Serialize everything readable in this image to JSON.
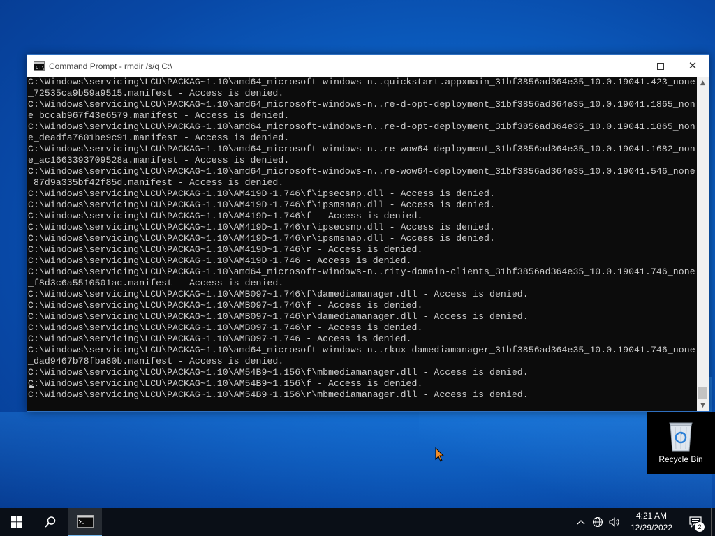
{
  "window": {
    "title": "Command Prompt - rmdir /s/q C:\\",
    "icon": "cmd-icon",
    "icon_text": "C:\\_"
  },
  "console": {
    "lines": [
      "C:\\Windows\\servicing\\LCU\\PACKAG~1.10\\amd64_microsoft-windows-n..quickstart.appxmain_31bf3856ad364e35_10.0.19041.423_none",
      "_72535ca9b59a9515.manifest - Access is denied.",
      "C:\\Windows\\servicing\\LCU\\PACKAG~1.10\\amd64_microsoft-windows-n..re-d-opt-deployment_31bf3856ad364e35_10.0.19041.1865_non",
      "e_bccab967f43e6579.manifest - Access is denied.",
      "C:\\Windows\\servicing\\LCU\\PACKAG~1.10\\amd64_microsoft-windows-n..re-d-opt-deployment_31bf3856ad364e35_10.0.19041.1865_non",
      "e_deadfa7601be9c91.manifest - Access is denied.",
      "C:\\Windows\\servicing\\LCU\\PACKAG~1.10\\amd64_microsoft-windows-n..re-wow64-deployment_31bf3856ad364e35_10.0.19041.1682_non",
      "e_ac1663393709528a.manifest - Access is denied.",
      "C:\\Windows\\servicing\\LCU\\PACKAG~1.10\\amd64_microsoft-windows-n..re-wow64-deployment_31bf3856ad364e35_10.0.19041.546_none",
      "_87d9a335bf42f85d.manifest - Access is denied.",
      "C:\\Windows\\servicing\\LCU\\PACKAG~1.10\\AM419D~1.746\\f\\ipsecsnp.dll - Access is denied.",
      "C:\\Windows\\servicing\\LCU\\PACKAG~1.10\\AM419D~1.746\\f\\ipsmsnap.dll - Access is denied.",
      "C:\\Windows\\servicing\\LCU\\PACKAG~1.10\\AM419D~1.746\\f - Access is denied.",
      "C:\\Windows\\servicing\\LCU\\PACKAG~1.10\\AM419D~1.746\\r\\ipsecsnp.dll - Access is denied.",
      "C:\\Windows\\servicing\\LCU\\PACKAG~1.10\\AM419D~1.746\\r\\ipsmsnap.dll - Access is denied.",
      "C:\\Windows\\servicing\\LCU\\PACKAG~1.10\\AM419D~1.746\\r - Access is denied.",
      "C:\\Windows\\servicing\\LCU\\PACKAG~1.10\\AM419D~1.746 - Access is denied.",
      "C:\\Windows\\servicing\\LCU\\PACKAG~1.10\\amd64_microsoft-windows-n..rity-domain-clients_31bf3856ad364e35_10.0.19041.746_none",
      "_f8d3c6a5510501ac.manifest - Access is denied.",
      "C:\\Windows\\servicing\\LCU\\PACKAG~1.10\\AMB097~1.746\\f\\damediamanager.dll - Access is denied.",
      "C:\\Windows\\servicing\\LCU\\PACKAG~1.10\\AMB097~1.746\\f - Access is denied.",
      "C:\\Windows\\servicing\\LCU\\PACKAG~1.10\\AMB097~1.746\\r\\damediamanager.dll - Access is denied.",
      "C:\\Windows\\servicing\\LCU\\PACKAG~1.10\\AMB097~1.746\\r - Access is denied.",
      "C:\\Windows\\servicing\\LCU\\PACKAG~1.10\\AMB097~1.746 - Access is denied.",
      "C:\\Windows\\servicing\\LCU\\PACKAG~1.10\\amd64_microsoft-windows-n..rkux-damediamanager_31bf3856ad364e35_10.0.19041.746_none",
      "_dad9467b78fba80b.manifest - Access is denied.",
      "C:\\Windows\\servicing\\LCU\\PACKAG~1.10\\AM54B9~1.156\\f\\mbmediamanager.dll - Access is denied.",
      "C:\\Windows\\servicing\\LCU\\PACKAG~1.10\\AM54B9~1.156\\f - Access is denied.",
      "C:\\Windows\\servicing\\LCU\\PACKAG~1.10\\AM54B9~1.156\\r\\mbmediamanager.dll - Access is denied."
    ]
  },
  "desktop": {
    "recycle_bin_label": "Recycle Bin"
  },
  "taskbar": {
    "start_icon": "windows-start-icon",
    "search_icon": "search-icon",
    "pinned_app_icon": "cmd-icon",
    "tray_icons": [
      "chevron-up-icon",
      "network-icon",
      "volume-icon"
    ],
    "time": "4:21 AM",
    "date": "12/29/2022",
    "notification_count": "2"
  },
  "colors": {
    "console_bg": "#0c0c0c",
    "console_text": "#cccccc",
    "taskbar_bg": "#0a0f17",
    "desktop_blue": "#0c63c7",
    "accent": "#76b9ed"
  }
}
